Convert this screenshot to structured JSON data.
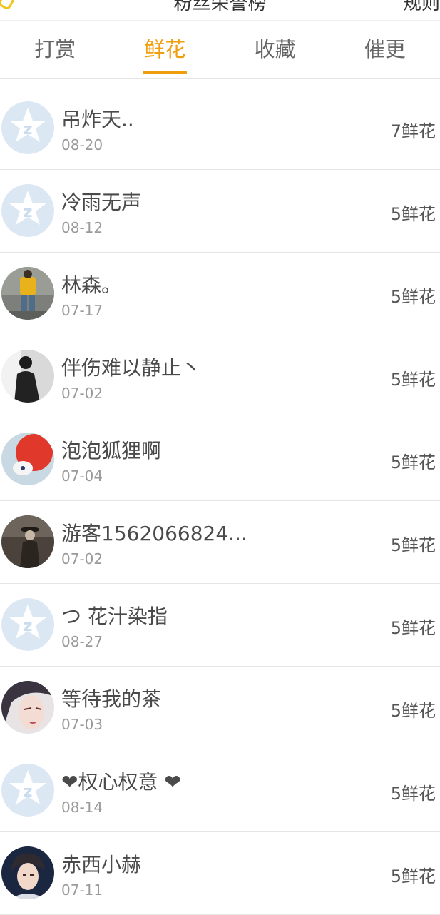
{
  "header": {
    "title": "粉丝荣誉榜",
    "right_text": "规则"
  },
  "tabs": [
    {
      "label": "打赏",
      "active": false
    },
    {
      "label": "鲜花",
      "active": true
    },
    {
      "label": "收藏",
      "active": false
    },
    {
      "label": "催更",
      "active": false
    }
  ],
  "colors": {
    "accent": "#ef9f0e",
    "default_avatar": "#dbe7f3"
  },
  "list": [
    {
      "name": "吊炸天..",
      "date": "08-20",
      "amount": "7鲜花",
      "avatar": "default-avatar-icon"
    },
    {
      "name": "冷雨无声",
      "date": "08-12",
      "amount": "5鲜花",
      "avatar": "default-avatar-icon"
    },
    {
      "name": "林森。",
      "date": "07-17",
      "amount": "5鲜花",
      "avatar": "user-photo-yellow-shirt"
    },
    {
      "name": "伴伤难以静止丶",
      "date": "07-02",
      "amount": "5鲜花",
      "avatar": "user-photo-dark-figure"
    },
    {
      "name": "泡泡狐狸啊",
      "date": "07-04",
      "amount": "5鲜花",
      "avatar": "user-photo-red-fox"
    },
    {
      "name": "游客1562066824...",
      "date": "07-02",
      "amount": "5鲜花",
      "avatar": "user-photo-sepia-portrait"
    },
    {
      "name": "つ 花汁染指",
      "date": "08-27",
      "amount": "5鲜花",
      "avatar": "default-avatar-icon"
    },
    {
      "name": "等待我的茶",
      "date": "07-03",
      "amount": "5鲜花",
      "avatar": "user-photo-anime-face"
    },
    {
      "name": "❤权心权意 ❤",
      "date": "08-14",
      "amount": "5鲜花",
      "avatar": "default-avatar-icon"
    },
    {
      "name": "赤西小赫",
      "date": "07-11",
      "amount": "5鲜花",
      "avatar": "user-photo-boy-portrait"
    }
  ]
}
